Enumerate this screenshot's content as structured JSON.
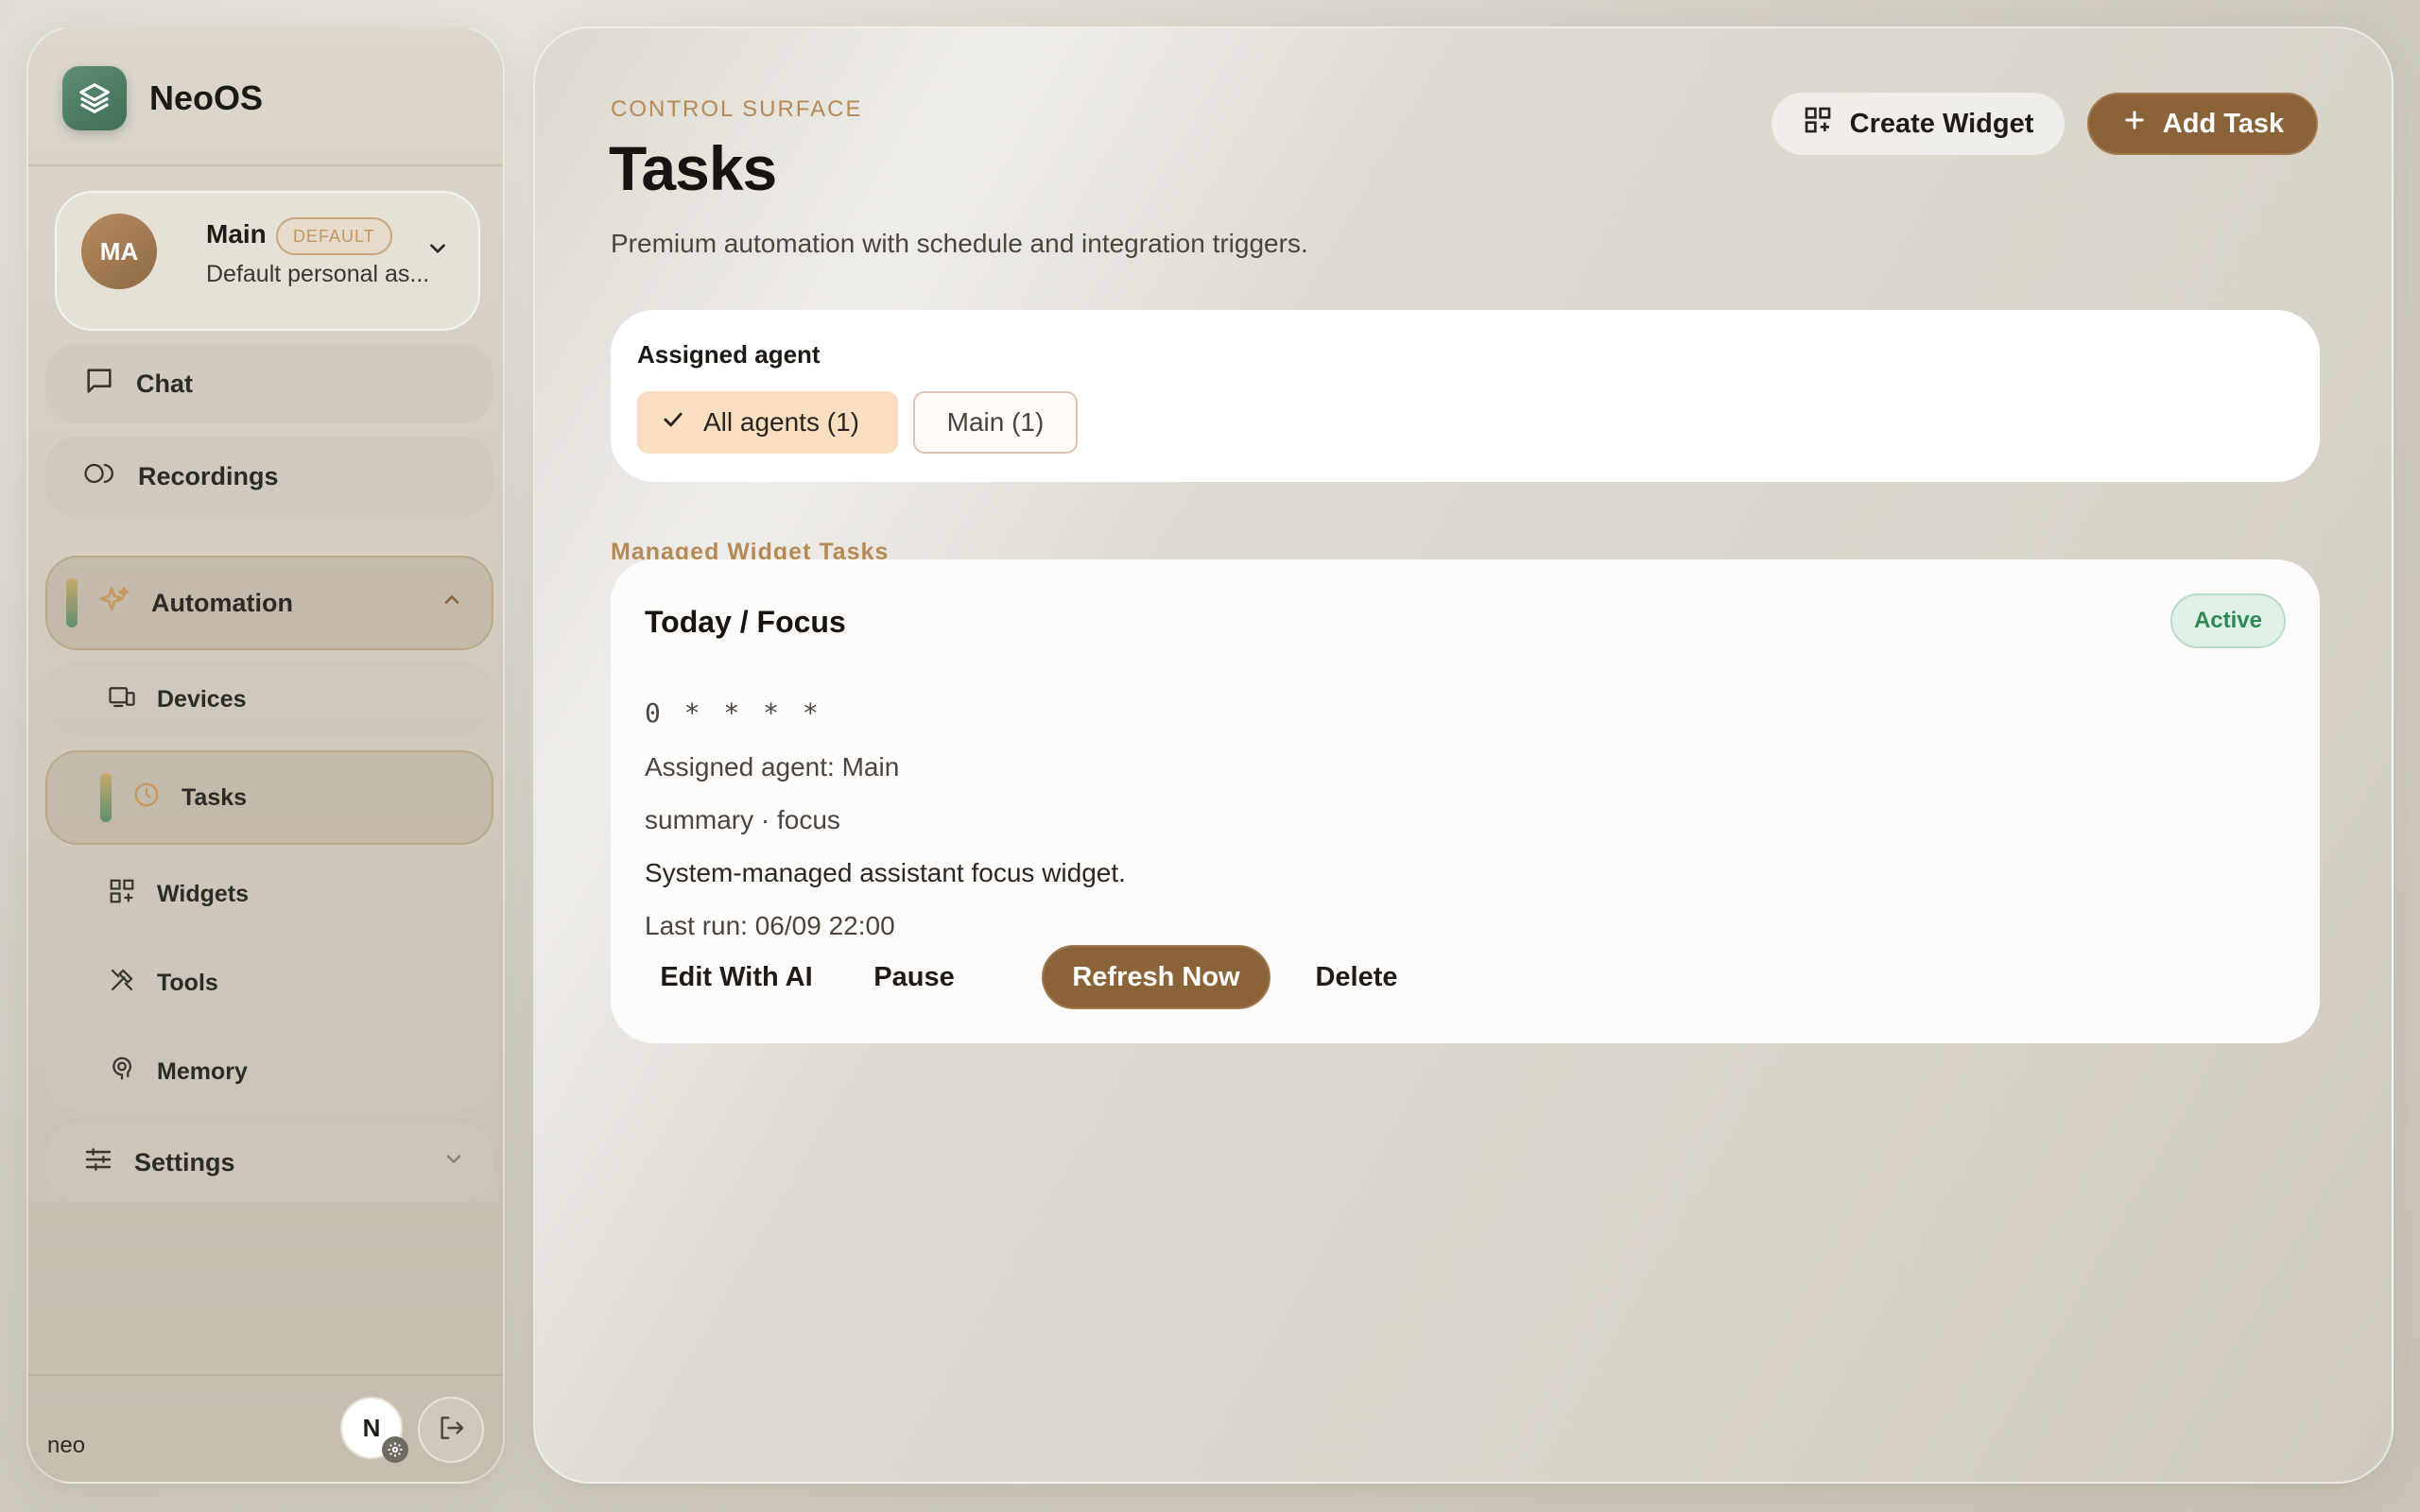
{
  "brand": {
    "name": "NeoOS"
  },
  "agent_switcher": {
    "initials": "MA",
    "name": "Main",
    "badge": "DEFAULT",
    "subtitle": "Default personal as..."
  },
  "nav": {
    "chat": "Chat",
    "recordings": "Recordings",
    "automation": "Automation",
    "devices": "Devices",
    "tasks": "Tasks",
    "widgets": "Widgets",
    "tools": "Tools",
    "memory": "Memory",
    "settings": "Settings"
  },
  "footer": {
    "username": "neo",
    "avatar_initial": "N"
  },
  "header": {
    "eyebrow": "CONTROL SURFACE",
    "title": "Tasks",
    "description": "Premium automation with schedule and integration triggers.",
    "create_widget_label": "Create Widget",
    "add_task_label": "Add Task"
  },
  "filter": {
    "label": "Assigned agent",
    "options": [
      {
        "label": "All agents (1)",
        "selected": true
      },
      {
        "label": "Main (1)",
        "selected": false
      }
    ]
  },
  "section": {
    "title": "Managed Widget Tasks"
  },
  "task": {
    "title": "Today / Focus",
    "status": "Active",
    "schedule": "0 * * * *",
    "assigned_agent": "Assigned agent: Main",
    "kind": "summary · focus",
    "description": "System-managed assistant focus widget.",
    "last_run": "Last run: 06/09 22:00",
    "actions": {
      "edit": "Edit With AI",
      "pause": "Pause",
      "refresh": "Refresh Now",
      "delete": "Delete"
    }
  },
  "colors": {
    "accent": "#8a6438",
    "eyebrow": "#b68a55",
    "active_status": "#2d8a55",
    "brand_logo": "#4f7d64"
  }
}
